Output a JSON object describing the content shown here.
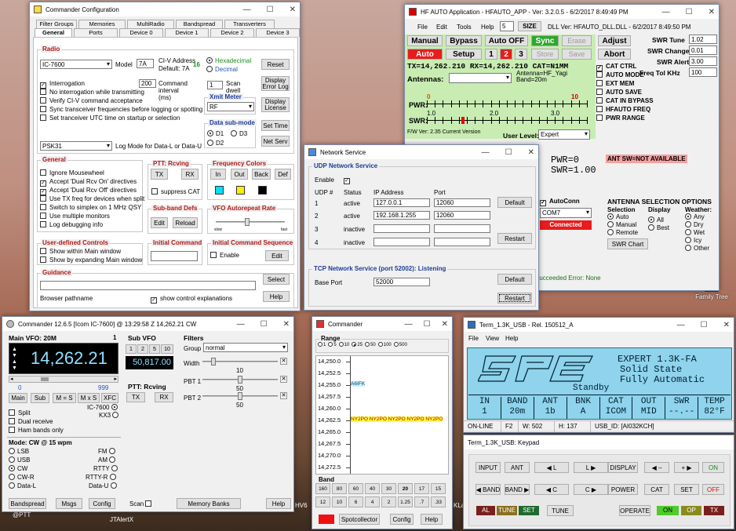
{
  "desktop": {
    "icon_label": "Family Tree",
    "taskbar_items": [
      "@PTT",
      "JTAlertX",
      "HV6",
      "KLa"
    ]
  },
  "cfg": {
    "title": "Commander Configuration",
    "tabs_row1": [
      "Filter Groups",
      "Memories",
      "MultiRadio",
      "Bandspread",
      "Transverters"
    ],
    "tabs_row2": [
      "General",
      "Ports",
      "Device 0",
      "Device 1",
      "Device 2",
      "Device 3"
    ],
    "radio": {
      "label": "Radio",
      "model_value": "IC-7600",
      "model_label": "Model",
      "model_code": "7A",
      "civ_label": "CI-V Address",
      "civ_value": "16",
      "civ_default": "Default: 7A",
      "hex": "Hexadecimal",
      "dec": "Decimal",
      "reset": "Reset",
      "interrogation": "Interrogation",
      "interval": "200",
      "cmd_interval": "Command interval (ms)",
      "no_interrog": "No interrogation while transmitting",
      "verify": "Verify CI-V command acceptance",
      "sync": "Sync transceiver frequencies before logging or spotting",
      "set_utc": "Set tranceiver UTC time on startup or selection",
      "scan_dwell_val": "1",
      "scan_dwell": "Scan dwell",
      "xmit_meter": "Xmit Meter",
      "xmit_value": "RF",
      "data_sub": "Data sub-mode",
      "d1": "D1",
      "d2": "D2",
      "d3": "D3",
      "display_log": "Display Error Log",
      "display_license": "Display License",
      "set_time": "Set Time",
      "net_serv": "Net Serv",
      "log_mode_value": "PSK31",
      "log_mode_label": "Log Mode for Data-L or Data-U"
    },
    "general": {
      "label": "General",
      "items": [
        "Ignore Mousewheel",
        "Accept 'Dual Rcv On' directives",
        "Accept 'Dual Rcv Off' directives",
        "Use TX freq for devices when split",
        "Switch to simplex on 1 MHz QSY",
        "Use multiple monitors",
        "Log debugging info"
      ]
    },
    "ptt": {
      "label": "PTT: Rcving",
      "tx": "TX",
      "rx": "RX",
      "suppress": "suppress CAT"
    },
    "freq_colors": {
      "label": "Frequency Colors",
      "in": "In",
      "out": "Out",
      "back": "Back",
      "def": "Def",
      "colors": [
        "#00e0ff",
        "#ffee00",
        "#000000"
      ]
    },
    "subband": {
      "label": "Sub-band Defs",
      "edit": "Edit",
      "reload": "Reload"
    },
    "vfo_rate": {
      "label": "VFO Autorepeat Rate",
      "slow": "slow",
      "fast": "fast",
      "level": 0.45
    },
    "user_ctrl": {
      "label": "User-defined Controls",
      "items": [
        "Show within Main window",
        "Show by expanding Main window"
      ]
    },
    "init_cmd": {
      "label": "Initial Command"
    },
    "init_seq": {
      "label": "Initial Command Sequence",
      "enable": "Enable",
      "edit": "Edit"
    },
    "guidance": {
      "label": "Guidance",
      "select": "Select",
      "browser": "Browser pathname",
      "show_expl": "show control explanations",
      "help": "Help"
    }
  },
  "hf": {
    "title": "HF AUTO Application  - HFAUTO_APP - Ver: 3.2.0.5 - 6/2/2017 8:49:49 PM",
    "menu": [
      "File",
      "Edit",
      "Tools",
      "Help"
    ],
    "size_val": "5",
    "size": "SIZE",
    "dll": "DLL Ver: HFAUTO_DLL.DLL - 6/2/2017 8:49:50 PM",
    "manual": "Manual",
    "bypass": "Bypass",
    "auto_off": "Auto OFF",
    "sync": "Sync",
    "erase": "Erase",
    "adjust": "Adjust",
    "auto": "Auto",
    "setup": "Setup",
    "n1": "1",
    "n2": "2",
    "n3": "3",
    "store": "Store",
    "save": "Save",
    "abort": "Abort",
    "txrx": "TX=14,262.210  RX=14,262.210  CAT=N1MM",
    "antennas": "Antennas:",
    "ant_info": "Antenna=HF_Yagi Band=20m",
    "pwr_lbl": "PWR:",
    "swr_lbl": "SWR:",
    "pwr_scale": [
      "0",
      "10"
    ],
    "swr_scale": [
      "1.0",
      "2.0",
      "3.0"
    ],
    "fw": "F/W Ver: 2.35  Current Version",
    "user_level": "User Level:",
    "user_level_val": "Expert",
    "right": [
      {
        "l": "SWR Tune",
        "v": "1.02"
      },
      {
        "l": "SWR Change",
        "v": "0.01"
      },
      {
        "l": "SWR Alert",
        "v": "3.00"
      },
      {
        "l": "Freq Tol KHz",
        "v": "100"
      }
    ],
    "checks": [
      {
        "t": "CAT CTRL",
        "on": true
      },
      {
        "t": "AUTO MODE",
        "on": false
      },
      {
        "t": "EXT MEM",
        "on": false
      },
      {
        "t": "AUTO SAVE",
        "on": false
      },
      {
        "t": "CAT IN BYPASS",
        "on": false
      },
      {
        "t": "HFAUTO FREQ",
        "on": false
      },
      {
        "t": "PWR RANGE",
        "on": false
      }
    ],
    "pwr": "PWR=0",
    "swr": "SWR=1.00",
    "swr_status": "ANT SW=NOT AVAILABLE",
    "autoconn": "AutoConn",
    "com": "COM7",
    "connected": "Connected",
    "ant_sel": "ANTENNA SELECTION OPTIONS",
    "selection": "Selection",
    "sel_opts": [
      "Auto",
      "Manual",
      "Remote"
    ],
    "display": "Display",
    "disp_opts": [
      "All",
      "Best"
    ],
    "weather": "Weather:",
    "weather_opts": [
      "Any",
      "Dry",
      "Wet",
      "Icy",
      "Other"
    ],
    "swr_chart": "SWR Chart",
    "status": "Succeeded   Error: None"
  },
  "net": {
    "title": "Network Service",
    "udp": "UDP Network Service",
    "enable": "Enable",
    "hdr": [
      "UDP #",
      "Status",
      "IP Address",
      "Port"
    ],
    "rows": [
      {
        "n": "1",
        "s": "active",
        "ip": "127.0.0.1",
        "p": "12060"
      },
      {
        "n": "2",
        "s": "active",
        "ip": "192.168.1.255",
        "p": "12060"
      },
      {
        "n": "3",
        "s": "inactive",
        "ip": "",
        "p": ""
      },
      {
        "n": "4",
        "s": "inactive",
        "ip": "",
        "p": ""
      }
    ],
    "default": "Default",
    "restart": "Restart",
    "tcp": "TCP Network Service (port 52002): Listening",
    "base_port": "Base Port",
    "base_val": "52000"
  },
  "cmd": {
    "title": "Commander 12.6.5 [Icom IC-7600] @ 13:29:58 Z  14,262.21 CW",
    "main_vfo": "Main VFO: 20M",
    "mv_idx": "1",
    "freq": "14,262.21",
    "scale_l": "0",
    "scale_r": "999",
    "main": "Main",
    "sub": "Sub",
    "meqs": "M = S",
    "mxs": "M x S",
    "xfc": "XFC",
    "split": "Split",
    "dual": "Dual receive",
    "ham": "Ham bands only",
    "radio1": "IC-7600",
    "radio2": "KX3",
    "mode_lbl": "Mode: CW @ 15 wpm",
    "modes_l": [
      "LSB",
      "USB",
      "CW",
      "CW-R",
      "Data-L"
    ],
    "modes_r": [
      "FM",
      "AM",
      "RTTY",
      "RTTY-R",
      "Data-U"
    ],
    "mode_sel": "CW",
    "sub_vfo": "Sub VFO",
    "steps": [
      "1",
      "2",
      "5",
      "10"
    ],
    "sub_freq": "50,817.00",
    "ptt": "PTT: Rcving",
    "tx": "TX",
    "rx": "RX",
    "filters": "Filters",
    "group": "Group",
    "group_val": "normal",
    "width": "Width",
    "width_val": "10",
    "width_pos": 0.12,
    "pbt1": "PBT 1",
    "pbt1_val": "50",
    "pbt1_pos": 0.5,
    "pbt2": "PBT 2",
    "pbt2_val": "50",
    "pbt2_pos": 0.5,
    "bandspread": "Bandspread",
    "msgs": "Msgs",
    "config": "Config",
    "scan": "Scan",
    "membanks": "Memory Banks",
    "help": "Help"
  },
  "spot": {
    "title": "Commander",
    "range": "Range",
    "range_opts": [
      "1",
      "5",
      "10",
      "25",
      "50",
      "100",
      "500"
    ],
    "range_sel": "25",
    "freqs": [
      "14,250.0",
      "14,252.5",
      "14,255.0",
      "14,257.5",
      "14,260.0",
      "14,262.5",
      "14,265.0",
      "14,267.5",
      "14,270.0",
      "14,272.5"
    ],
    "spots": [
      {
        "f": "14,255.0",
        "t": "A6IFK"
      },
      {
        "f": "14,262.5",
        "t": "NY2PO NY2PO NY2PO NY2PO NY2PO"
      }
    ],
    "band": "Band",
    "bands1": [
      "160",
      "80",
      "60",
      "40",
      "30",
      "20",
      "17",
      "15"
    ],
    "bands2": [
      "12",
      "10",
      "6",
      "4",
      "2",
      "1.25",
      ".7",
      ".33"
    ],
    "band_sel": "20",
    "spotcollector": "Spotcollector",
    "config": "Config",
    "help": "Help"
  },
  "term": {
    "title": "Term_1.3K_USB - Rel. 150512_A",
    "menu": [
      "File",
      "View",
      "Help"
    ],
    "expert": "EXPERT 1.3K-FA",
    "solid": "Solid State",
    "fully": "Fully Automatic",
    "standby": "Standby",
    "cols": [
      {
        "h": "IN",
        "v": "1"
      },
      {
        "h": "BAND",
        "v": "20m"
      },
      {
        "h": "ANT",
        "v": "1b"
      },
      {
        "h": "BNK",
        "v": "A"
      },
      {
        "h": "CAT",
        "v": "ICOM"
      },
      {
        "h": "OUT",
        "v": "MID"
      },
      {
        "h": "SWR",
        "v": "--.--"
      },
      {
        "h": "TEMP",
        "v": "82°F"
      }
    ],
    "status": [
      "ON-LINE",
      "F2",
      "W: 502",
      "H: 137",
      "USB_ID: [AI032KCH]"
    ]
  },
  "kp": {
    "title": "Term_1.3K_USB: Keypad",
    "input": "INPUT",
    "ant": "ANT",
    "left": "◀ L",
    "lr": "L ▶",
    "display": "DISPLAY",
    "dm": "◀ –",
    "dp": "+ ▶",
    "on": "ON",
    "band_l": "◀ BAND",
    "band_r": "BAND ▶",
    "cl": "◀ C",
    "cr": "C ▶",
    "power": "POWER",
    "cat": "CAT",
    "set": "SET",
    "off": "OFF",
    "al": "AL",
    "tune_led": "TUNE",
    "set_led": "SET",
    "tune": "TUNE",
    "operate": "OPERATE",
    "on_led": "ON",
    "op_led": "OP",
    "tx_led": "TX"
  }
}
